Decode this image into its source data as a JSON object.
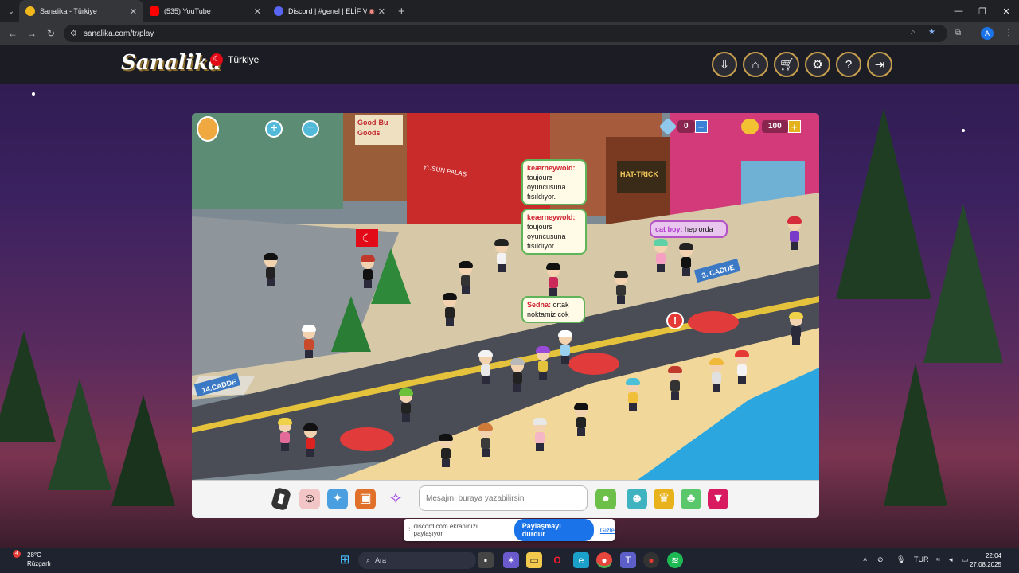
{
  "browser": {
    "tabs": [
      {
        "title": "Sanalika - Türkiye",
        "favicon_color": "#f0b81a",
        "active": true
      },
      {
        "title": "(535) YouTube",
        "favicon_color": "#ff0000",
        "active": false
      },
      {
        "title": "Discord | #genel | ELİF VE B",
        "favicon_color": "#5865f2",
        "active": false
      }
    ],
    "url": "sanalika.com/tr/play",
    "profile_initial": "A"
  },
  "site": {
    "logo": "Sanalika",
    "country": "Türkiye",
    "toolbar_icons": [
      "download-icon",
      "home-icon",
      "cart-icon",
      "settings-icon",
      "help-icon",
      "logout-icon"
    ]
  },
  "game": {
    "diamonds": "0",
    "coins": "100",
    "bubbles": [
      {
        "user": "keærneywold:",
        "text": "toujours oyuncusuna fısıldıyor."
      },
      {
        "user": "keærneywold:",
        "text": "toujours oyuncusuna fısıldıyor."
      },
      {
        "user": "Sedna:",
        "text": "ortak noktamiz cok"
      },
      {
        "user": "cat boy:",
        "text": "hep orda"
      }
    ],
    "signs": {
      "street_14": "14.CADDE",
      "street_3": "3. CADDE",
      "shop_good": "Good-Bu Goods",
      "shop_hat": "HAT-TRICK",
      "shop_palas": "YUSUN PALAS"
    },
    "chat_placeholder": "Mesajını buraya yazabilirsin",
    "chatbar_icons": [
      "phone-icon",
      "emote-icon",
      "dance-icon",
      "bag-icon",
      "run-icon",
      "speech-icon",
      "robot-icon",
      "trophy-icon",
      "island-icon",
      "heart-drop-icon"
    ]
  },
  "share": {
    "message": "discord.com ekranınızı paylaşıyor.",
    "stop_label": "Paylaşmayı durdur",
    "hide_label": "Gizle"
  },
  "taskbar": {
    "temperature": "28°C",
    "condition": "Rüzgarlı",
    "search_placeholder": "Ara",
    "lang": "TUR",
    "time": "22:04",
    "date": "27.08.2025"
  }
}
